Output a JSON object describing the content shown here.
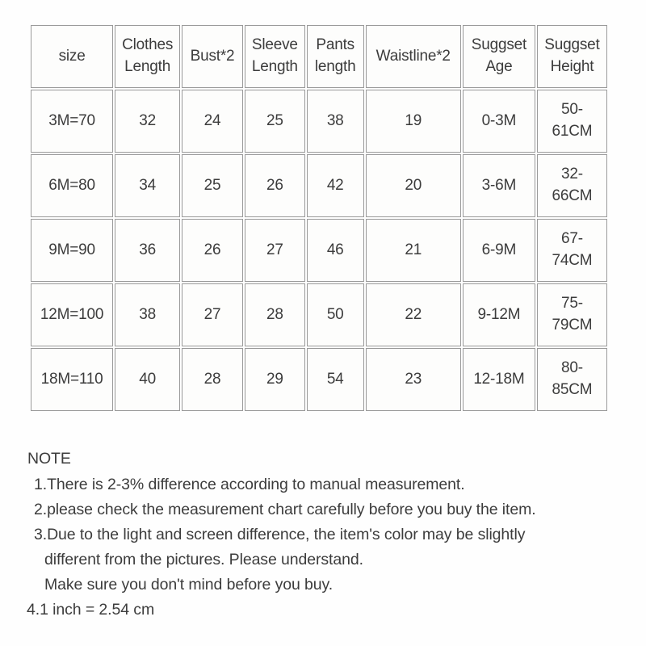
{
  "table": {
    "headers": [
      {
        "name": "size",
        "lines": [
          "size"
        ]
      },
      {
        "name": "clothes-length",
        "lines": [
          "Clothes",
          "Length"
        ]
      },
      {
        "name": "bust",
        "lines": [
          "Bust*2"
        ]
      },
      {
        "name": "sleeve-length",
        "lines": [
          "Sleeve",
          "Length"
        ]
      },
      {
        "name": "pants-length",
        "lines": [
          "Pants",
          "length"
        ]
      },
      {
        "name": "waistline",
        "lines": [
          "Waistline*2"
        ]
      },
      {
        "name": "suggset-age",
        "lines": [
          "Suggset",
          "Age"
        ]
      },
      {
        "name": "suggset-height",
        "lines": [
          "Suggset",
          "Height"
        ]
      }
    ],
    "rows": [
      {
        "size": "3M=70",
        "clothes_length": "32",
        "bust": "24",
        "sleeve_length": "25",
        "pants_length": "38",
        "waistline": "19",
        "age": "0-3M",
        "height_lines": [
          "50-",
          "61CM"
        ]
      },
      {
        "size": "6M=80",
        "clothes_length": "34",
        "bust": "25",
        "sleeve_length": "26",
        "pants_length": "42",
        "waistline": "20",
        "age": "3-6M",
        "height_lines": [
          "32-",
          "66CM"
        ]
      },
      {
        "size": "9M=90",
        "clothes_length": "36",
        "bust": "26",
        "sleeve_length": "27",
        "pants_length": "46",
        "waistline": "21",
        "age": "6-9M",
        "height_lines": [
          "67-",
          "74CM"
        ]
      },
      {
        "size": "12M=100",
        "clothes_length": "38",
        "bust": "27",
        "sleeve_length": "28",
        "pants_length": "50",
        "waistline": "22",
        "age": "9-12M",
        "height_lines": [
          "75-",
          "79CM"
        ]
      },
      {
        "size": "18M=110",
        "clothes_length": "40",
        "bust": "28",
        "sleeve_length": "29",
        "pants_length": "54",
        "waistline": "23",
        "age": "12-18M",
        "height_lines": [
          "80-",
          "85CM"
        ]
      }
    ]
  },
  "note": {
    "title": "NOTE",
    "lines": [
      "1.There is 2-3% difference according to manual measurement.",
      "2.please check the measurement chart carefully before you buy the item.",
      "3.Due to the light and screen difference, the item's color may be slightly",
      "different from the pictures. Please understand.",
      "Make sure you don't mind before you buy.",
      "4.1 inch = 2.54 cm"
    ]
  },
  "chart_data": {
    "type": "table",
    "title": "Baby clothing size chart",
    "columns": [
      "size",
      "Clothes Length",
      "Bust*2",
      "Sleeve Length",
      "Pants length",
      "Waistline*2",
      "Suggset Age",
      "Suggset Height"
    ],
    "units": "cm",
    "rows": [
      [
        "3M=70",
        32,
        24,
        25,
        38,
        19,
        "0-3M",
        "50-61CM"
      ],
      [
        "6M=80",
        34,
        25,
        26,
        42,
        20,
        "3-6M",
        "32-66CM"
      ],
      [
        "9M=90",
        36,
        26,
        27,
        46,
        21,
        "6-9M",
        "67-74CM"
      ],
      [
        "12M=100",
        38,
        27,
        28,
        50,
        22,
        "9-12M",
        "75-79CM"
      ],
      [
        "18M=110",
        40,
        28,
        29,
        54,
        23,
        "12-18M",
        "80-85CM"
      ]
    ]
  },
  "colors": {
    "text": "#3c3c3c",
    "border": "#9a9a9a",
    "cell_background": "#fdfdfc",
    "page_background": "#fefefe"
  }
}
